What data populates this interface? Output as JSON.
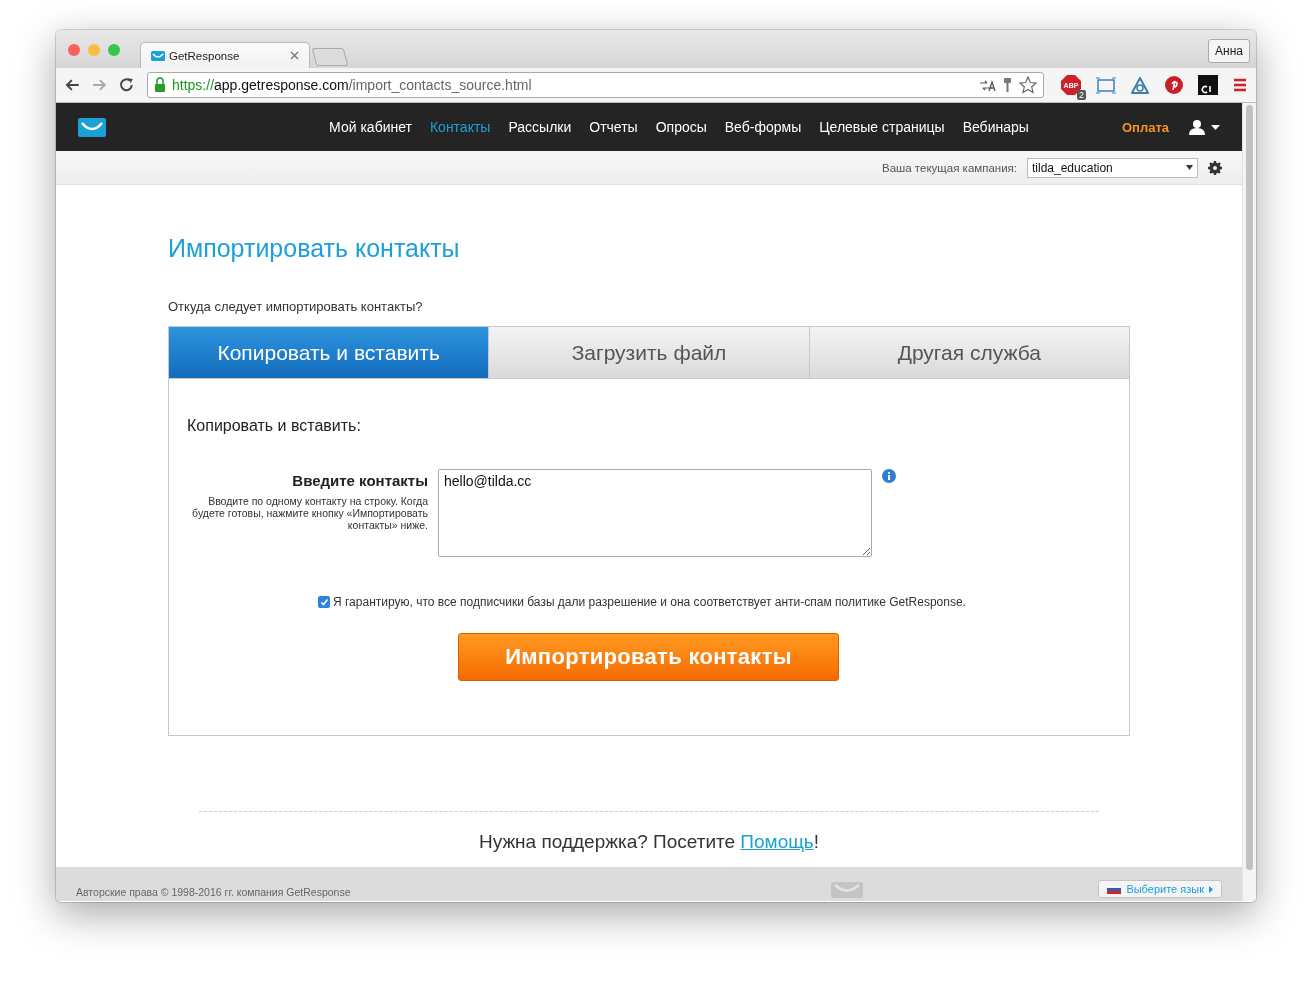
{
  "browser": {
    "tab_title": "GetResponse",
    "profile": "Анна",
    "url_scheme": "https://",
    "url_host": "app.getresponse.com",
    "url_path": "/import_contacts_source.html",
    "abp_label": "ABP",
    "abp_badge": "2"
  },
  "nav": {
    "items": [
      {
        "label": "Мой кабинет",
        "selected": false
      },
      {
        "label": "Контакты",
        "selected": true
      },
      {
        "label": "Рассылки",
        "selected": false
      },
      {
        "label": "Отчеты",
        "selected": false
      },
      {
        "label": "Опросы",
        "selected": false
      },
      {
        "label": "Веб-формы",
        "selected": false
      },
      {
        "label": "Целевые страницы",
        "selected": false
      },
      {
        "label": "Вебинары",
        "selected": false
      }
    ],
    "payment": "Оплата"
  },
  "campaign": {
    "label": "Ваша текущая кампания:",
    "value": "tilda_education"
  },
  "page": {
    "title": "Импортировать контакты",
    "question": "Откуда следует импортировать контакты?"
  },
  "tabs": [
    {
      "label": "Копировать и вставить",
      "selected": true
    },
    {
      "label": "Загрузить файл",
      "selected": false
    },
    {
      "label": "Другая служба",
      "selected": false
    }
  ],
  "panel": {
    "heading": "Копировать и вставить:",
    "field_label": "Введите контакты",
    "field_hint": "Вводите по одному контакту на строку. Когда будете готовы, нажмите кнопку «Импортировать контакты» ниже.",
    "field_value": "hello@tilda.cc",
    "consent": {
      "label": "Я гарантирую, что все подписчики базы дали разрешение и она соответствует анти-спам политике GetResponse.",
      "checked": true
    },
    "submit": "Импортировать контакты"
  },
  "support": {
    "text": "Нужна поддержка? Посетите ",
    "link": "Помощь",
    "end": "!"
  },
  "footer": {
    "copyright": "Авторские права © 1998-2016 гг. компания GetResponse",
    "language": "Выберите язык"
  }
}
